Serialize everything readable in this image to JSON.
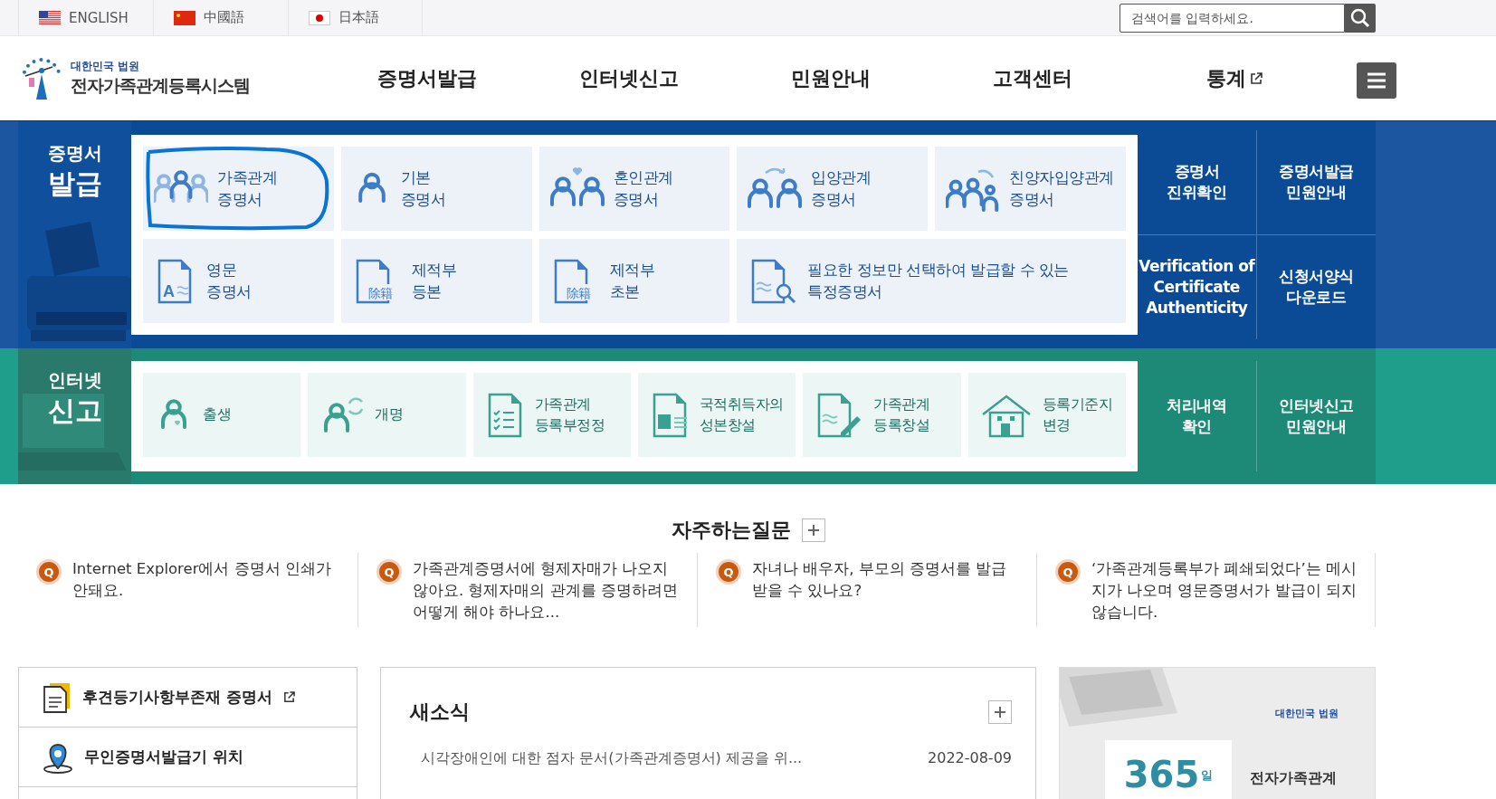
{
  "languages": [
    {
      "label": "ENGLISH",
      "kind": "us"
    },
    {
      "label": "中國語",
      "kind": "cn"
    },
    {
      "label": "日本語",
      "kind": "jp"
    }
  ],
  "search": {
    "placeholder": "검색어를 입력하세요."
  },
  "logo": {
    "org": "대한민국 법원",
    "system": "전자가족관계등록시스템"
  },
  "nav": [
    {
      "label": "증명서발급",
      "external": false
    },
    {
      "label": "인터넷신고",
      "external": false
    },
    {
      "label": "민원안내",
      "external": false
    },
    {
      "label": "고객센터",
      "external": false
    },
    {
      "label": "통계",
      "external": true
    }
  ],
  "certificate_section": {
    "title_top": "증명서",
    "title_main": "발급",
    "tiles": [
      {
        "kind": "family",
        "label": "가족관계\n증명서",
        "wide": false,
        "circled": true
      },
      {
        "kind": "person",
        "label": "기본\n증명서",
        "wide": false,
        "circled": false
      },
      {
        "kind": "couple",
        "label": "혼인관계\n증명서",
        "wide": false,
        "circled": false
      },
      {
        "kind": "adopt",
        "label": "입양관계\n증명서",
        "wide": false,
        "circled": false
      },
      {
        "kind": "adopt3",
        "label": "친양자입양관계\n증명서",
        "wide": false,
        "circled": false
      },
      {
        "kind": "english",
        "icon_text": "A",
        "label": "영문\n증명서",
        "wide": false,
        "circled": false
      },
      {
        "kind": "removed",
        "icon_text": "除籍",
        "label": "제적부\n등본",
        "wide": false,
        "circled": false
      },
      {
        "kind": "removed",
        "icon_text": "除籍",
        "label": "제적부\n초본",
        "wide": false,
        "circled": false
      },
      {
        "kind": "search",
        "label": "필요한 정보만 선택하여 발급할 수 있는\n특정증명서",
        "wide": true,
        "circled": false
      }
    ],
    "links": [
      "증명서\n진위확인",
      "증명서발급\n민원안내",
      "Verification of\nCertificate\nAuthenticity",
      "신청서양식\n다운로드"
    ]
  },
  "report_section": {
    "title_top": "인터넷",
    "title_main": "신고",
    "tiles": [
      {
        "kind": "birth",
        "label": "출생"
      },
      {
        "kind": "rename",
        "label": "개명"
      },
      {
        "kind": "checklist",
        "label": "가족관계\n등록부정정"
      },
      {
        "kind": "idcard",
        "label": "국적취득자의\n성본창설"
      },
      {
        "kind": "pen",
        "label": "가족관계\n등록창설"
      },
      {
        "kind": "house",
        "label": "등록기준지\n변경"
      }
    ],
    "links": [
      "처리내역\n확인",
      "인터넷신고\n민원안내"
    ]
  },
  "faq": {
    "title": "자주하는질문",
    "items": [
      {
        "badge": "Q",
        "text": "Internet Explorer에서 증명서 인쇄가 안돼요."
      },
      {
        "badge": "Q",
        "text": "가족관계증명서에 형제자매가 나오지 않아요. 형제자매의 관계를 증명하려면 어떻게 해야 하나요..."
      },
      {
        "badge": "Q",
        "text": "자녀나 배우자, 부모의 증명서를 발급 받을 수 있나요?"
      },
      {
        "badge": "Q",
        "text": "‘가족관계등록부가 폐쇄되었다’는 메시지가 나오며 영문증명서가 발급이 되지 않습니다."
      }
    ]
  },
  "quick_links": [
    {
      "kind": "document",
      "label": "후견등기사항부존재 증명서",
      "external": true
    },
    {
      "kind": "pin",
      "label": "무인증명서발급기 위치",
      "external": false
    }
  ],
  "news": {
    "title": "새소식",
    "items": [
      {
        "text": "시각장애인에 대한 점자 문서(가족관계증명서) 제공을 위...",
        "date": "2022-08-09"
      }
    ]
  },
  "banner": {
    "org": "대한민국 법원",
    "number": "365",
    "unit": "일",
    "caption": "전자가족관계"
  }
}
